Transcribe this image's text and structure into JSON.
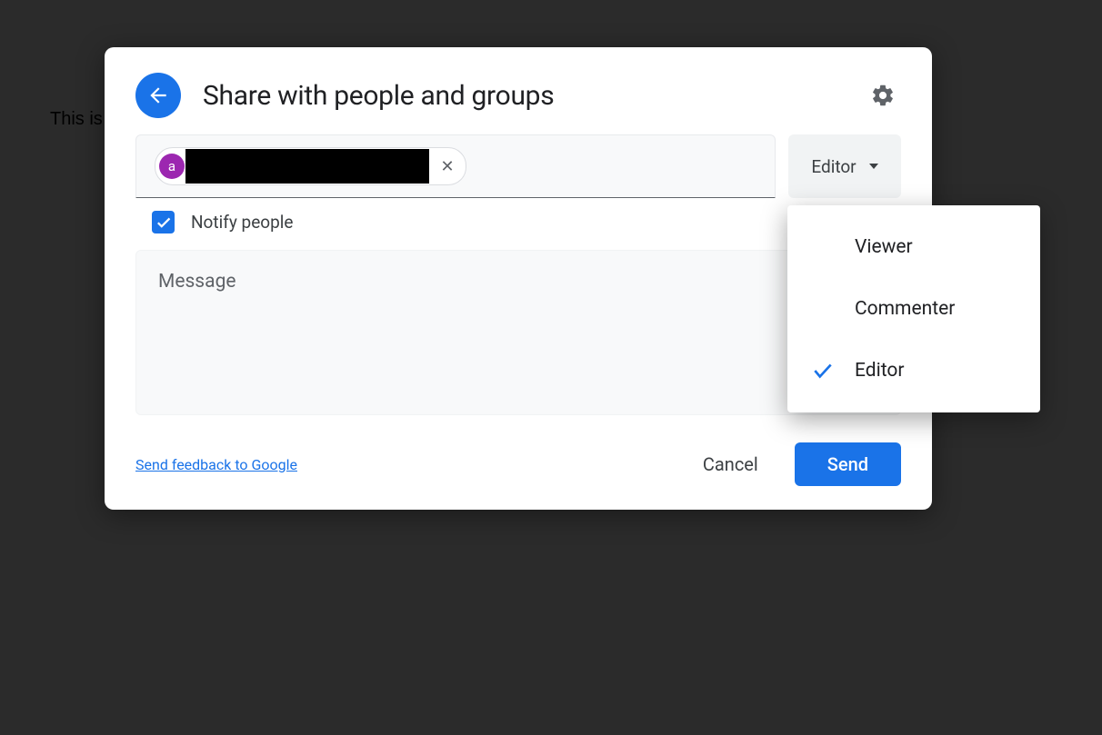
{
  "background_doc_text": "This is",
  "dialog": {
    "title": "Share with people and groups",
    "chip": {
      "avatar_letter": "a",
      "remove_glyph": "✕"
    },
    "role_button_label": "Editor",
    "notify": {
      "checked": true,
      "label": "Notify people"
    },
    "message_placeholder": "Message",
    "footer": {
      "feedback": "Send feedback to Google",
      "cancel": "Cancel",
      "send": "Send"
    }
  },
  "dropdown": {
    "items": [
      {
        "label": "Viewer",
        "selected": false
      },
      {
        "label": "Commenter",
        "selected": false
      },
      {
        "label": "Editor",
        "selected": true
      }
    ]
  }
}
